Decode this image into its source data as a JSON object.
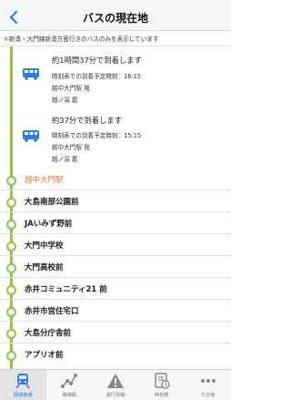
{
  "header": {
    "title": "バスの現在地"
  },
  "notice": {
    "text": "①新湊・大門線新湊方面行きのバスのみを表示しています"
  },
  "buses": [
    {
      "arrival": "約1時間37分で到着します",
      "scheduled": "時刻表での到着予定時刻：16:15",
      "origin": "越中大門駅 発",
      "destination": "越ノ潟 着"
    },
    {
      "arrival": "約37分で到着します",
      "scheduled": "時刻表での到着予定時刻：15:15",
      "origin": "越中大門駅 発",
      "destination": "越ノ潟 着"
    }
  ],
  "stops": [
    {
      "name": "越中大門駅",
      "current": true
    },
    {
      "name": "大島南部公園前",
      "current": false
    },
    {
      "name": "JAいみず野前",
      "current": false
    },
    {
      "name": "大門中学校",
      "current": false
    },
    {
      "name": "大門高校前",
      "current": false
    },
    {
      "name": "赤井コミュニティ21 前",
      "current": false
    },
    {
      "name": "赤井市営住宅口",
      "current": false
    },
    {
      "name": "大島分庁舎前",
      "current": false
    },
    {
      "name": "アプリオ前",
      "current": false
    }
  ],
  "tabbar": {
    "items": [
      {
        "label": "経路検索",
        "icon": "train-icon",
        "active": true
      },
      {
        "label": "路線図",
        "icon": "route-map-icon",
        "active": false
      },
      {
        "label": "運行情報",
        "icon": "warning-icon",
        "active": false
      },
      {
        "label": "時刻表",
        "icon": "timetable-icon",
        "active": false
      },
      {
        "label": "その他",
        "icon": "more-icon",
        "active": false
      }
    ]
  },
  "colors": {
    "accent": "#2a7de1",
    "route_line": "#8dc63f",
    "current_stop": "#e8762b"
  }
}
